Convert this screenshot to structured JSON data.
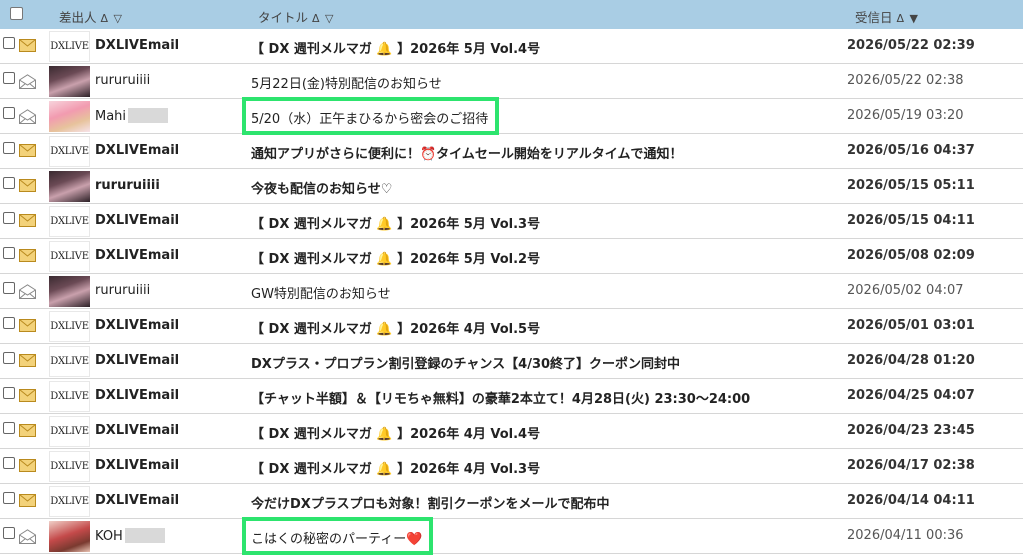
{
  "header": {
    "sender_label": "差出人",
    "sender_sort": "Δ ▽",
    "title_label": "タイトル",
    "title_sort": "Δ ▽",
    "date_label": "受信日",
    "date_sort": "Δ ▼"
  },
  "colors": {
    "header_bg": "#a9cde4",
    "highlight": "#2de46e",
    "envelope_unread": "#e8b94a"
  },
  "messages": [
    {
      "avatar": "dxlive-logo",
      "logo_text": "DXLIVE",
      "sender": "DXLIVEmail",
      "title": "【 DX 週刊メルマガ 🔔 】2026年 5月 Vol.4号",
      "date": "2026/05/22 02:39",
      "unread": true
    },
    {
      "avatar": "photo",
      "sender": "rururuiiii",
      "title": "5月22日(金)特別配信のお知らせ",
      "date": "2026/05/22 02:38",
      "unread": false
    },
    {
      "avatar": "photo-pink",
      "sender": "Mahi",
      "redacted": true,
      "title": "5/20（水）正午まひるから密会のご招待",
      "date": "2026/05/19 03:20",
      "unread": false,
      "highlighted": true
    },
    {
      "avatar": "dxlive-logo",
      "logo_text": "DXLIVE",
      "sender": "DXLIVEmail",
      "title": "通知アプリがさらに便利に！⏰タイムセール開始をリアルタイムで通知！",
      "date": "2026/05/16 04:37",
      "unread": true
    },
    {
      "avatar": "photo",
      "sender": "rururuiiii",
      "title": "今夜も配信のお知らせ♡",
      "date": "2026/05/15 05:11",
      "unread": true
    },
    {
      "avatar": "dxlive-logo",
      "logo_text": "DXLIVE",
      "sender": "DXLIVEmail",
      "title": "【 DX 週刊メルマガ 🔔 】2026年 5月 Vol.3号",
      "date": "2026/05/15 04:11",
      "unread": true
    },
    {
      "avatar": "dxlive-logo",
      "logo_text": "DXLIVE",
      "sender": "DXLIVEmail",
      "title": "【 DX 週刊メルマガ 🔔 】2026年 5月 Vol.2号",
      "date": "2026/05/08 02:09",
      "unread": true
    },
    {
      "avatar": "photo",
      "sender": "rururuiiii",
      "title": "GW特別配信のお知らせ",
      "date": "2026/05/02 04:07",
      "unread": false
    },
    {
      "avatar": "dxlive-logo",
      "logo_text": "DXLIVE",
      "sender": "DXLIVEmail",
      "title": "【 DX 週刊メルマガ 🔔 】2026年 4月 Vol.5号",
      "date": "2026/05/01 03:01",
      "unread": true
    },
    {
      "avatar": "dxlive-logo",
      "logo_text": "DXLIVE",
      "sender": "DXLIVEmail",
      "title": "DXプラス・プロプラン割引登録のチャンス【4/30終了】クーポン同封中",
      "date": "2026/04/28 01:20",
      "unread": true
    },
    {
      "avatar": "dxlive-logo",
      "logo_text": "DXLIVE",
      "sender": "DXLIVEmail",
      "title": "【チャット半額】＆【リモちゃ無料】の豪華2本立て！4月28日(火) 23:30～24:00",
      "date": "2026/04/25 04:07",
      "unread": true
    },
    {
      "avatar": "dxlive-logo",
      "logo_text": "DXLIVE",
      "sender": "DXLIVEmail",
      "title": "【 DX 週刊メルマガ 🔔 】2026年 4月 Vol.4号",
      "date": "2026/04/23 23:45",
      "unread": true
    },
    {
      "avatar": "dxlive-logo",
      "logo_text": "DXLIVE",
      "sender": "DXLIVEmail",
      "title": "【 DX 週刊メルマガ 🔔 】2026年 4月 Vol.3号",
      "date": "2026/04/17 02:38",
      "unread": true
    },
    {
      "avatar": "dxlive-logo",
      "logo_text": "DXLIVE",
      "sender": "DXLIVEmail",
      "title": "今だけDXプラスプロも対象！割引クーポンをメールで配布中",
      "date": "2026/04/14 04:11",
      "unread": true
    },
    {
      "avatar": "photo-red",
      "sender": "KOH",
      "redacted": true,
      "title": "こはくの秘密のパーティー❤️",
      "date": "2026/04/11 00:36",
      "unread": false,
      "highlighted": true
    }
  ]
}
